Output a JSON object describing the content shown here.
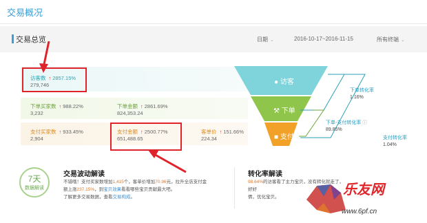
{
  "page_title": "交易概况",
  "section": {
    "title": "交易总览",
    "date_label": "日期",
    "date_range": "2016-10-17~2016-11-15",
    "terminal_label": "所有终端"
  },
  "funnel": {
    "visitors": {
      "label": "访客数",
      "pct": "2857.15%",
      "value": "279,746"
    },
    "order_buyers": {
      "label": "下单买家数",
      "pct": "988.22%",
      "value": "3,232"
    },
    "order_amount": {
      "label": "下单金额",
      "pct": "2861.69%",
      "value": "824,353.24"
    },
    "pay_buyers": {
      "label": "支付买家数",
      "pct": "933.45%",
      "value": "2,904"
    },
    "pay_amount": {
      "label": "支付金额",
      "pct": "2500.77%",
      "value": "651,488.65"
    },
    "unit_price": {
      "label": "客单价",
      "pct": "151.66%",
      "value": "224.34"
    },
    "stage_visit": "访客",
    "stage_order": "下单",
    "stage_pay": "支付",
    "conv_order": {
      "label": "下单转化率",
      "value": "1.16%"
    },
    "conv_order_pay": {
      "label": "下单-支付转化率",
      "value": "89.85%"
    },
    "conv_pay": {
      "label": "支付转化率",
      "value": "1.04%"
    }
  },
  "badge": {
    "num": "7天",
    "sub": "数据解读"
  },
  "wave": {
    "title": "交易波动解读",
    "line1a": "不错哦！支付买家数增加",
    "line1b": "1,415",
    "line1c": "个，客单价增加",
    "line1d": "70.96",
    "line1e": "元，拉升全店支付金",
    "line2a": "额上涨",
    "line2b": "237.15%",
    "line2c": "，到",
    "line2d": "宝贝效果",
    "line2e": "看看哪些宝贝贡献最大吧。",
    "line3a": "了解更多交易数据，",
    "line3b": "查看",
    "line3c": "交易构成",
    "line3d": "。"
  },
  "conversion": {
    "title": "转化率解读",
    "line1a": "98.64%",
    "line1b": "的访客看了主力宝贝，没有转化就走了，好好",
    "line2": "倩，优化宝贝。"
  },
  "watermark": {
    "brand": "乐友网",
    "url": "www.6pf.cn"
  },
  "colors": {
    "accent": "#3a9fd6",
    "funnel_top": "#7fd3da",
    "funnel_mid": "#8fc54a",
    "funnel_bottom": "#f2a128",
    "highlight_box": "#e0222a"
  }
}
